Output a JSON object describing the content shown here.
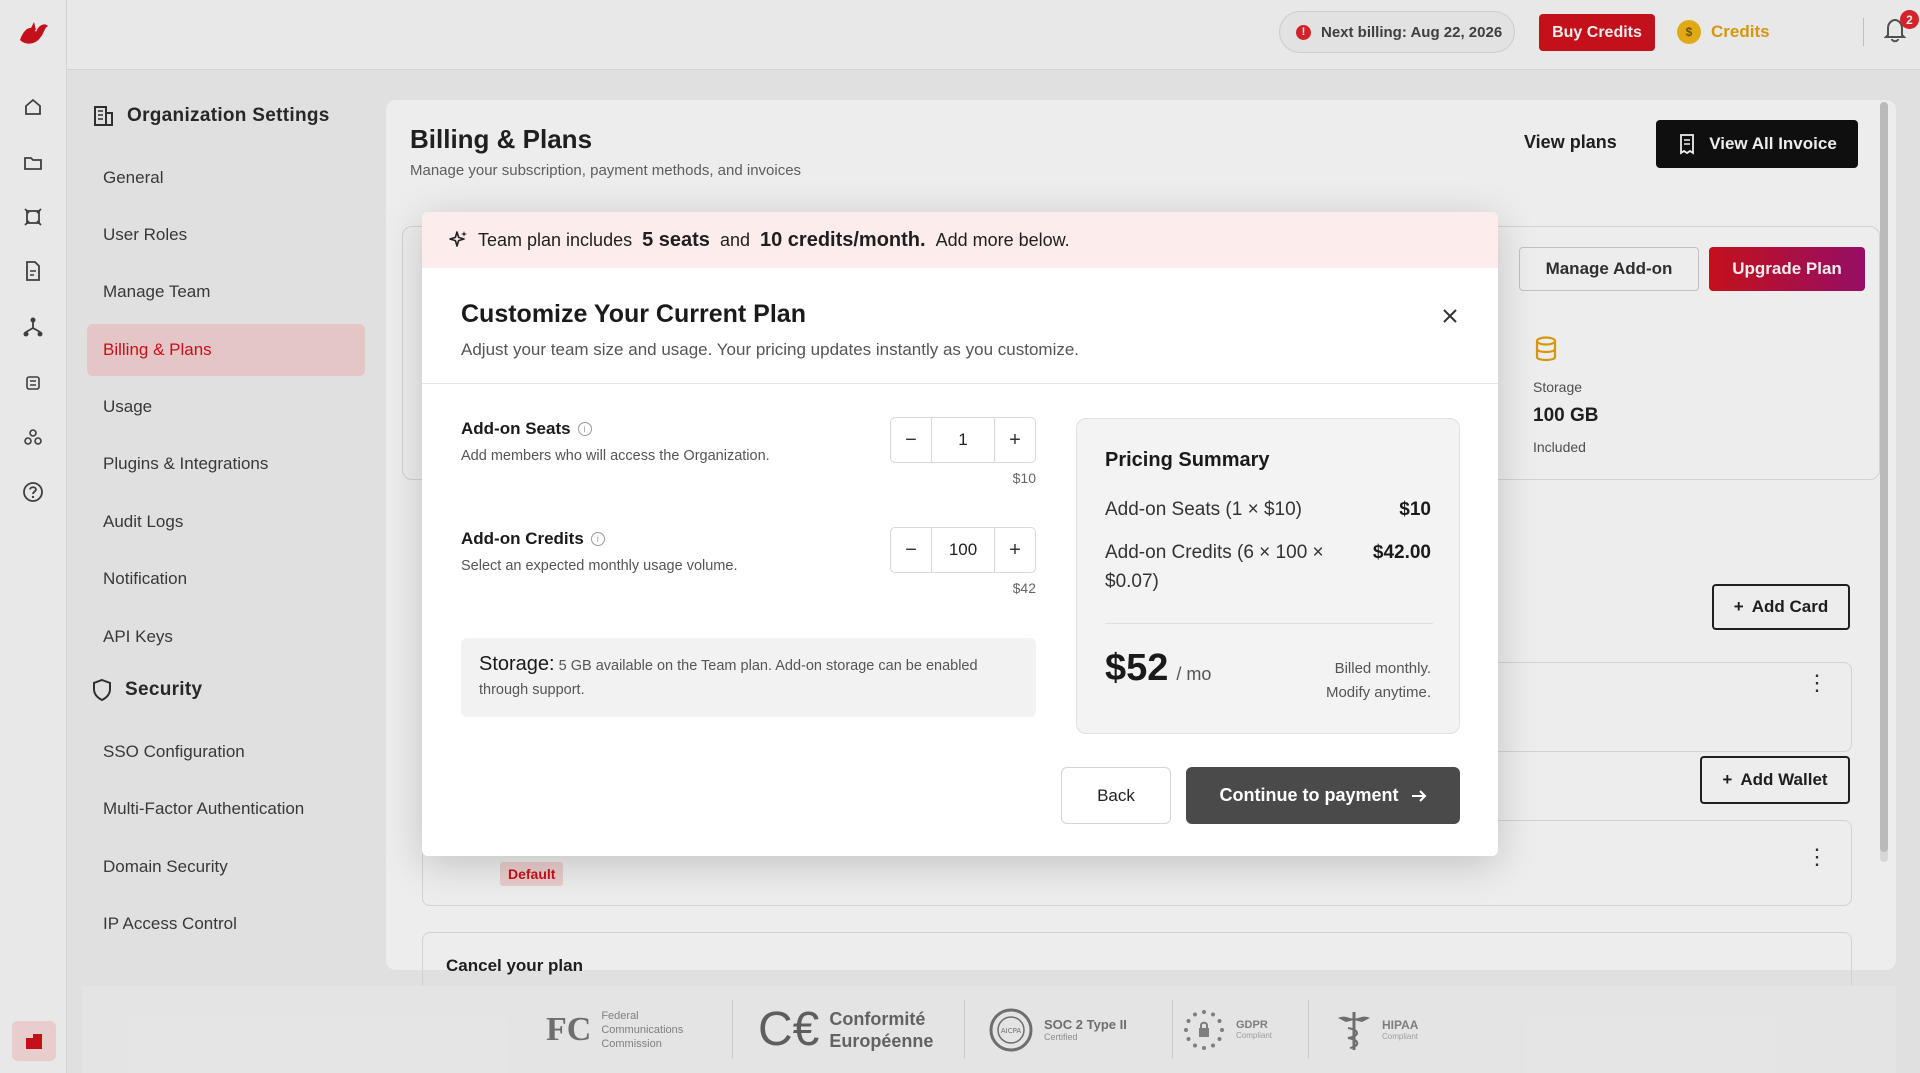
{
  "topbar": {
    "next_billing": "Next billing: Aug 22, 2026",
    "buy_credits": "Buy Credits",
    "credits_label": "Credits",
    "notification_count": "2"
  },
  "settings_nav": {
    "org_heading": "Organization Settings",
    "org_items": [
      "General",
      "User Roles",
      "Manage Team",
      "Billing & Plans",
      "Usage",
      "Plugins & Integrations",
      "Audit Logs",
      "Notification",
      "API Keys"
    ],
    "security_heading": "Security",
    "security_items": [
      "SSO Configuration",
      "Multi-Factor Authentication",
      "Domain Security",
      "IP Access Control"
    ],
    "active_item": "Billing & Plans"
  },
  "billing": {
    "title": "Billing & Plans",
    "subtitle": "Manage your subscription, payment methods, and invoices",
    "view_plans": "View plans",
    "view_all_invoice": "View All Invoice",
    "manage_addon": "Manage Add-on",
    "upgrade_plan": "Upgrade Plan",
    "storage_label": "Storage",
    "storage_value": "100 GB",
    "storage_included": "Included",
    "add_card": "Add Card",
    "add_wallet": "Add Wallet",
    "default_tag": "Default",
    "cancel_title": "Cancel your plan"
  },
  "footer": {
    "fcc": [
      "Federal",
      "Communications",
      "Commission"
    ],
    "ce": [
      "Conformité",
      "Européenne"
    ],
    "soc": "SOC 2 Type II",
    "soc_sub": "Certified",
    "gdpr": "GDPR",
    "gdpr_sub": "Compliant",
    "hipaa": "HIPAA",
    "hipaa_sub": "Compliant"
  },
  "modal": {
    "banner": {
      "prefix": "Team plan includes",
      "seats": "5 seats",
      "and": "and",
      "credits": "10 credits/month.",
      "suffix": "Add more below."
    },
    "title": "Customize Your Current Plan",
    "subtitle": "Adjust your team size and usage. Your pricing updates instantly as you customize.",
    "seats": {
      "label": "Add-on Seats",
      "desc": "Add members who will access the Organization.",
      "value": "1",
      "price": "$10"
    },
    "credits": {
      "label": "Add-on Credits",
      "desc": "Select an expected monthly usage volume.",
      "value": "100",
      "price": "$42"
    },
    "storage": {
      "key": "Storage:",
      "text": "5 GB available on the Team plan. Add-on storage can be enabled through support."
    },
    "summary": {
      "title": "Pricing Summary",
      "seats_line": "Add-on Seats (1 × $10)",
      "seats_value": "$10",
      "credits_line": "Add-on Credits (6 × 100 × $0.07)",
      "credits_value": "$42.00",
      "total": "$52",
      "per": "/ mo",
      "billed_1": "Billed monthly.",
      "billed_2": "Modify anytime."
    },
    "back": "Back",
    "continue": "Continue to payment"
  },
  "colors": {
    "brand_red": "#d3121e",
    "accent_gold": "#e7a20f",
    "banner_bg": "#fdecec",
    "continue_bg": "#4a4a4a"
  }
}
